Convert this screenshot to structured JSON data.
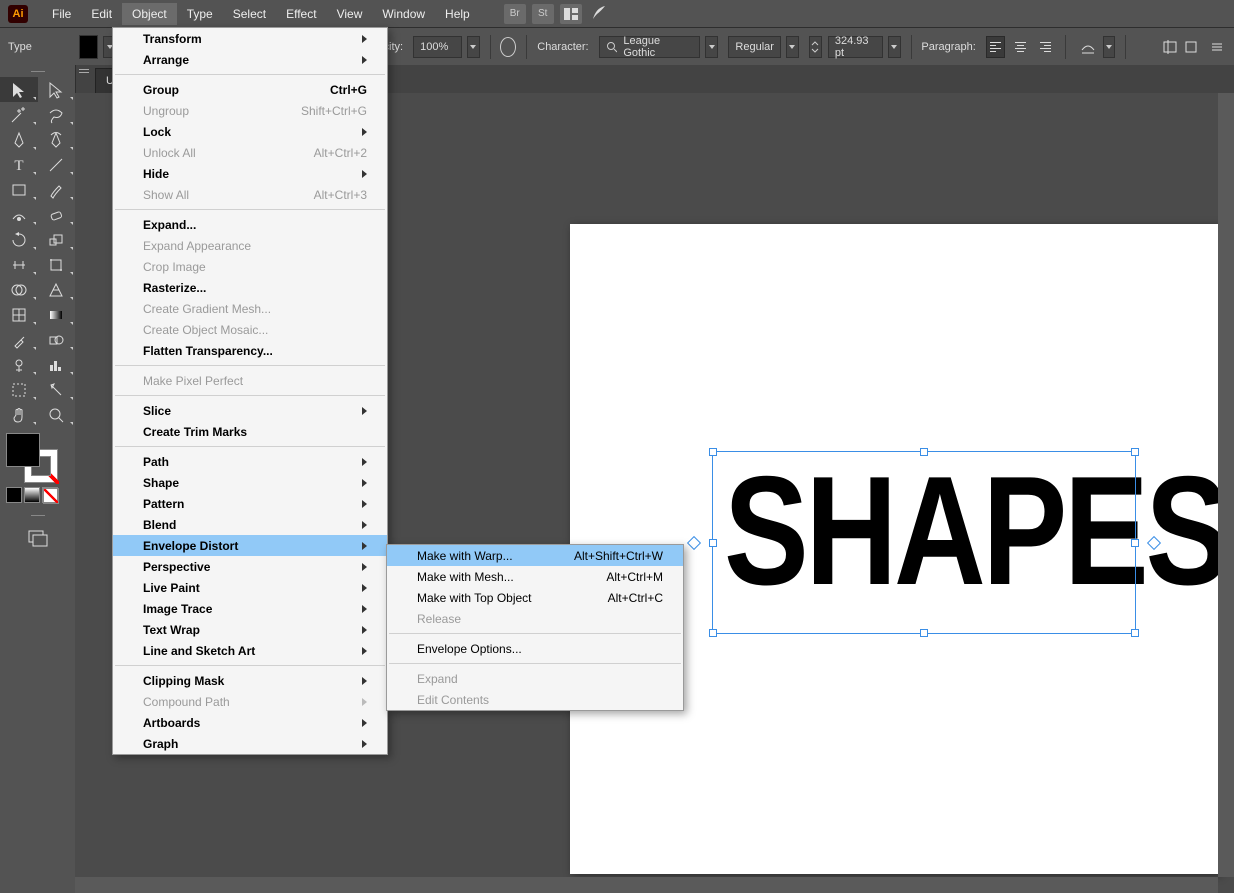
{
  "menubar": {
    "logo": "Ai",
    "items": [
      "File",
      "Edit",
      "Object",
      "Type",
      "Select",
      "Effect",
      "View",
      "Window",
      "Help"
    ],
    "open_index": 2,
    "extra": {
      "br": "Br",
      "st": "St"
    }
  },
  "ctrlbar": {
    "mode": "Type",
    "opacity_label": "Opacity:",
    "opacity_value": "100%",
    "character_label": "Character:",
    "font": "League Gothic",
    "style": "Regular",
    "size": "324.93 pt",
    "paragraph_label": "Paragraph:"
  },
  "tab": {
    "title": "Untitl"
  },
  "dropdown": {
    "main": [
      {
        "label": "Transform",
        "arrow": true,
        "bold": true
      },
      {
        "label": "Arrange",
        "arrow": true,
        "bold": true
      },
      {
        "sep": true
      },
      {
        "label": "Group",
        "shortcut": "Ctrl+G",
        "bold": true
      },
      {
        "label": "Ungroup",
        "shortcut": "Shift+Ctrl+G",
        "disabled": true
      },
      {
        "label": "Lock",
        "arrow": true,
        "bold": true
      },
      {
        "label": "Unlock All",
        "shortcut": "Alt+Ctrl+2",
        "disabled": true
      },
      {
        "label": "Hide",
        "arrow": true,
        "bold": true
      },
      {
        "label": "Show All",
        "shortcut": "Alt+Ctrl+3",
        "disabled": true
      },
      {
        "sep": true
      },
      {
        "label": "Expand...",
        "bold": true
      },
      {
        "label": "Expand Appearance",
        "disabled": true
      },
      {
        "label": "Crop Image",
        "disabled": true
      },
      {
        "label": "Rasterize...",
        "bold": true
      },
      {
        "label": "Create Gradient Mesh...",
        "disabled": true
      },
      {
        "label": "Create Object Mosaic...",
        "disabled": true
      },
      {
        "label": "Flatten Transparency...",
        "bold": true
      },
      {
        "sep": true
      },
      {
        "label": "Make Pixel Perfect",
        "disabled": true
      },
      {
        "sep": true
      },
      {
        "label": "Slice",
        "arrow": true,
        "bold": true
      },
      {
        "label": "Create Trim Marks",
        "bold": true
      },
      {
        "sep": true
      },
      {
        "label": "Path",
        "arrow": true,
        "bold": true
      },
      {
        "label": "Shape",
        "arrow": true,
        "bold": true
      },
      {
        "label": "Pattern",
        "arrow": true,
        "bold": true
      },
      {
        "label": "Blend",
        "arrow": true,
        "bold": true
      },
      {
        "label": "Envelope Distort",
        "arrow": true,
        "bold": true,
        "hover": true
      },
      {
        "label": "Perspective",
        "arrow": true,
        "bold": true
      },
      {
        "label": "Live Paint",
        "arrow": true,
        "bold": true
      },
      {
        "label": "Image Trace",
        "arrow": true,
        "bold": true
      },
      {
        "label": "Text Wrap",
        "arrow": true,
        "bold": true
      },
      {
        "label": "Line and Sketch Art",
        "arrow": true,
        "bold": true
      },
      {
        "sep": true
      },
      {
        "label": "Clipping Mask",
        "arrow": true,
        "bold": true
      },
      {
        "label": "Compound Path",
        "arrow": true,
        "disabled": true
      },
      {
        "label": "Artboards",
        "arrow": true,
        "bold": true
      },
      {
        "label": "Graph",
        "arrow": true,
        "bold": true
      }
    ],
    "sub": [
      {
        "label": "Make with Warp...",
        "shortcut": "Alt+Shift+Ctrl+W",
        "hover": true
      },
      {
        "label": "Make with Mesh...",
        "shortcut": "Alt+Ctrl+M"
      },
      {
        "label": "Make with Top Object",
        "shortcut": "Alt+Ctrl+C"
      },
      {
        "label": "Release",
        "disabled": true
      },
      {
        "sep": true
      },
      {
        "label": "Envelope Options..."
      },
      {
        "sep": true
      },
      {
        "label": "Expand",
        "disabled": true
      },
      {
        "label": "Edit Contents",
        "disabled": true
      }
    ]
  },
  "canvas": {
    "text": "SHAPES"
  },
  "tool_letter": "T"
}
